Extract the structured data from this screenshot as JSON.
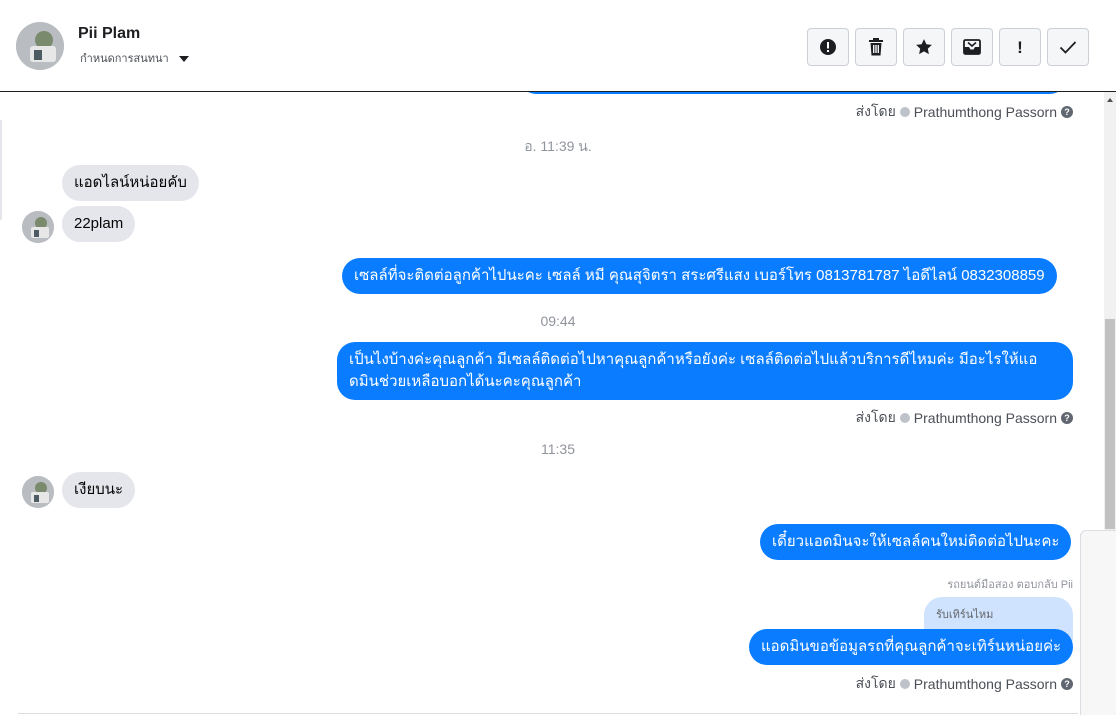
{
  "header": {
    "contact_name": "Pii Plam",
    "conversation_menu_label": "กำหนดการสนทนา",
    "toolbar": [
      "report-icon",
      "trash-icon",
      "star-icon",
      "inbox-move-icon",
      "important-icon",
      "check-icon"
    ]
  },
  "messages": [
    {
      "sent_by_label": "ส่งโดย",
      "agent": "Prathumthong Passorn"
    },
    {
      "time": "อ. 11:39 น."
    },
    {
      "incoming_1": "แอดไลน์หน่อยคับ",
      "incoming_2": "22plam"
    },
    {
      "outgoing": "เซลล์ที่จะติดต่อลูกค้าไปนะคะ เซลล์ หมี คุณสุจิตรา สระศรีแสง เบอร์โทร 0813781787 ไอดีไลน์ 0832308859"
    },
    {
      "time": "09:44"
    },
    {
      "outgoing": "เป็นไงบ้างค่ะคุณลูกค้า มีเซลล์ติดต่อไปหาคุณลูกค้าหรือยังค่ะ  เซลล์ติดต่อไปแล้วบริการดีไหมค่ะ มีอะไรให้แอดมินช่วยเหลือบอกได้นะคะคุณลูกค้า",
      "sent_by_label": "ส่งโดย",
      "agent": "Prathumthong Passorn"
    },
    {
      "time": "11:35"
    },
    {
      "incoming": "เงียบนะ"
    },
    {
      "outgoing": "เดี๋ยวแอดมินจะให้เซลล์คนใหม่ติดต่อไปนะคะ"
    },
    {
      "reply_note": "รถยนต์มือสอง ตอบกลับ Pii",
      "quoted": "รับเทิร์นไหม",
      "outgoing": "แอดมินขอข้อมูลรถที่คุณลูกค้าจะเทิร์นหน่อยค่ะ",
      "sent_by_label": "ส่งโดย",
      "agent": "Prathumthong Passorn"
    }
  ],
  "colors": {
    "outgoing_bubble": "#0a7cff",
    "incoming_bubble": "#e4e6eb"
  }
}
